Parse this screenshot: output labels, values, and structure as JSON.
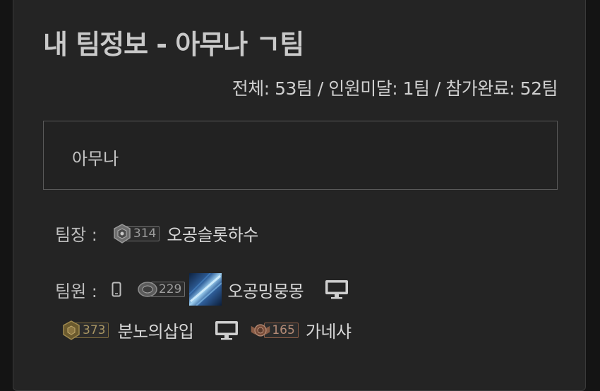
{
  "header": {
    "title": "내 팀정보 - 아무나 ㄱ팀",
    "stats": "전체: 53팀 / 인원미달: 1팀 / 참가완료: 52팀"
  },
  "description": {
    "text": "아무나"
  },
  "leader": {
    "label": "팀장 :",
    "level": "314",
    "name": "오공슬롯하수"
  },
  "members": {
    "label": "팀원 :",
    "items": [
      {
        "device": "mobile-icon",
        "level": "229",
        "name": "오공밍뭉몽",
        "has_avatar": true,
        "trailing_device": "monitor-icon"
      },
      {
        "level": "373",
        "name": "분노의삽입",
        "trailing_device": "monitor-icon"
      },
      {
        "level": "165",
        "name": "가네샤"
      }
    ]
  },
  "colors": {
    "background": "#141414",
    "panel": "#242424",
    "title_text": "#c9c9c9",
    "body_text": "#d8d8d8",
    "gold_badge": "#a89563",
    "bronze_badge": "#b48b76"
  }
}
